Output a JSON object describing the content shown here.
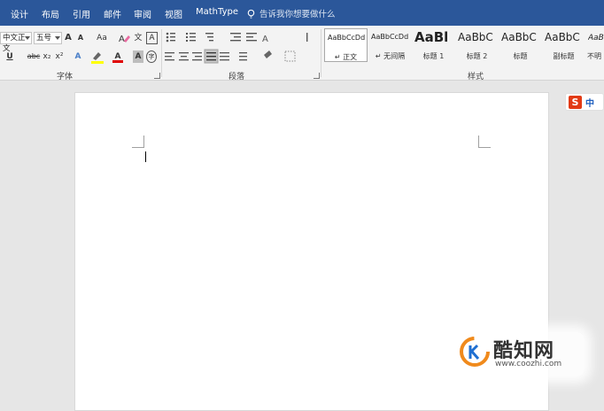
{
  "ribbon_tabs": [
    "设计",
    "布局",
    "引用",
    "邮件",
    "审阅",
    "视图",
    "MathType"
  ],
  "tell_me": {
    "placeholder": "告诉我你想要做什么"
  },
  "font_group": {
    "label": "字体",
    "font_name": "中文正文",
    "font_size": "五号",
    "grow_font": "A",
    "shrink_font": "A",
    "change_case": "Aa",
    "wen_char": "文",
    "char_border": "A",
    "underline": "U",
    "strikethrough": "abc",
    "subscript": "x₂",
    "superscript": "x²",
    "text_effects": "A",
    "font_color": "A",
    "char_shading": "A",
    "enclose": "字"
  },
  "paragraph_group": {
    "label": "段落"
  },
  "styles_group": {
    "label": "样式",
    "items": [
      {
        "sample": "AaBbCcDd",
        "name": "↵ 正文"
      },
      {
        "sample": "AaBbCcDd",
        "name": "↵ 无间隔"
      },
      {
        "sample": "AaBl",
        "name": "标题 1"
      },
      {
        "sample": "AaBbC",
        "name": "标题 2"
      },
      {
        "sample": "AaBbC",
        "name": "标题"
      },
      {
        "sample": "AaBbC",
        "name": "副标题"
      },
      {
        "sample": "AaBb",
        "name": "不明"
      }
    ]
  },
  "ime": {
    "logo": "S",
    "lang": "中"
  },
  "watermark": {
    "name": "酷知网",
    "url": "www.coozhi.com"
  },
  "colors": {
    "title_bar": "#2b579a",
    "ribbon": "#f3f3f3",
    "canvas": "#e6e6e6",
    "highlight": "#ffff00",
    "font_red": "#e00000"
  }
}
